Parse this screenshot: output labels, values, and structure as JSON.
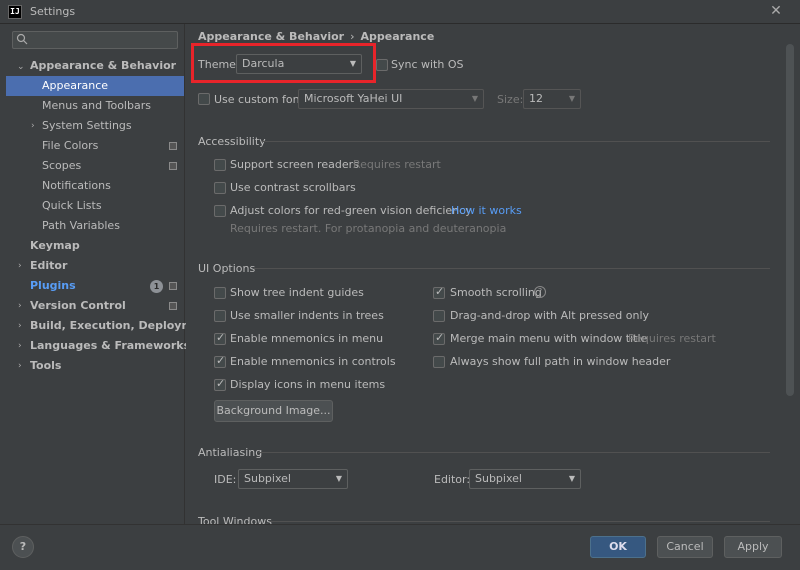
{
  "window": {
    "title": "Settings",
    "app_icon_text": "IJ"
  },
  "sidebar": {
    "search_placeholder": "",
    "items": [
      {
        "label": "Appearance & Behavior"
      },
      {
        "label": "Appearance"
      },
      {
        "label": "Menus and Toolbars"
      },
      {
        "label": "System Settings"
      },
      {
        "label": "File Colors"
      },
      {
        "label": "Scopes"
      },
      {
        "label": "Notifications"
      },
      {
        "label": "Quick Lists"
      },
      {
        "label": "Path Variables"
      },
      {
        "label": "Keymap"
      },
      {
        "label": "Editor"
      },
      {
        "label": "Plugins",
        "badge": "1"
      },
      {
        "label": "Version Control"
      },
      {
        "label": "Build, Execution, Deployment"
      },
      {
        "label": "Languages & Frameworks"
      },
      {
        "label": "Tools"
      }
    ]
  },
  "breadcrumb": {
    "parent": "Appearance & Behavior",
    "sep": "›",
    "current": "Appearance"
  },
  "theme": {
    "label": "Theme:",
    "value": "Darcula",
    "sync_label": "Sync with OS"
  },
  "font": {
    "label": "Use custom font:",
    "value": "Microsoft YaHei UI",
    "size_label": "Size:",
    "size_value": "12"
  },
  "accessibility": {
    "title": "Accessibility",
    "screen_readers": "Support screen readers",
    "screen_readers_hint": "Requires restart",
    "contrast": "Use contrast scrollbars",
    "color_deficiency": "Adjust colors for red-green vision deficiency",
    "how_it_works": "How it works",
    "color_hint": "Requires restart. For protanopia and deuteranopia"
  },
  "ui_options": {
    "title": "UI Options",
    "tree_guides": "Show tree indent guides",
    "smaller_indents": "Use smaller indents in trees",
    "mnemonics_menu": "Enable mnemonics in menu",
    "mnemonics_controls": "Enable mnemonics in controls",
    "display_icons": "Display icons in menu items",
    "background_btn": "Background Image...",
    "smooth_scrolling": "Smooth scrolling",
    "drag_drop": "Drag-and-drop with Alt pressed only",
    "merge_menu": "Merge main menu with window title",
    "merge_hint": "Requires restart",
    "full_path": "Always show full path in window header"
  },
  "antialiasing": {
    "title": "Antialiasing",
    "ide_label": "IDE:",
    "ide_value": "Subpixel",
    "editor_label": "Editor:",
    "editor_value": "Subpixel"
  },
  "tool_windows": {
    "title": "Tool Windows"
  },
  "footer": {
    "ok": "OK",
    "cancel": "Cancel",
    "apply": "Apply",
    "help": "?"
  },
  "colors": {
    "accent": "#4b6eaf",
    "highlight": "#e8242a",
    "link": "#589df6"
  }
}
